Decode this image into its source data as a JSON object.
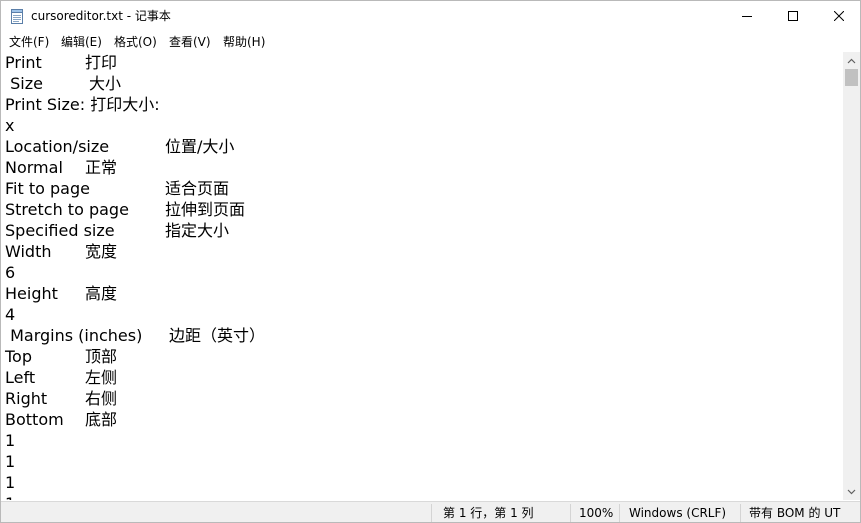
{
  "window": {
    "title": "cursoreditor.txt - 记事本"
  },
  "menu": {
    "file": "文件(F)",
    "edit": "编辑(E)",
    "format": "格式(O)",
    "view": "查看(V)",
    "help": "帮助(H)"
  },
  "lines": [
    {
      "a": "Print",
      "b": "打印"
    },
    {
      "a": " Size",
      "b": "大小"
    },
    {
      "a": "Print Size: 打印大小:",
      "b": ""
    },
    {
      "a": "x",
      "b": ""
    },
    {
      "a": "Location/size",
      "b": "位置/大小"
    },
    {
      "a": "Normal",
      "b": "正常"
    },
    {
      "a": "Fit to page",
      "b": "适合页面"
    },
    {
      "a": "Stretch to page",
      "b": "拉伸到页面"
    },
    {
      "a": "Specified size",
      "b": "指定大小"
    },
    {
      "a": "Width",
      "b": "宽度"
    },
    {
      "a": "6",
      "b": ""
    },
    {
      "a": "Height",
      "b": "高度"
    },
    {
      "a": "4",
      "b": ""
    },
    {
      "a": " Margins (inches)",
      "b": "边距（英寸）"
    },
    {
      "a": "Top",
      "b": "顶部"
    },
    {
      "a": "Left",
      "b": "左侧"
    },
    {
      "a": "Right",
      "b": "右侧"
    },
    {
      "a": "Bottom",
      "b": "底部"
    },
    {
      "a": "1",
      "b": ""
    },
    {
      "a": "1",
      "b": ""
    },
    {
      "a": "1",
      "b": ""
    },
    {
      "a": "1",
      "b": ""
    }
  ],
  "status": {
    "position": "第 1 行，第 1 列",
    "zoom": "100%",
    "line_ending": "Windows (CRLF)",
    "encoding": "带有 BOM 的 UT"
  }
}
